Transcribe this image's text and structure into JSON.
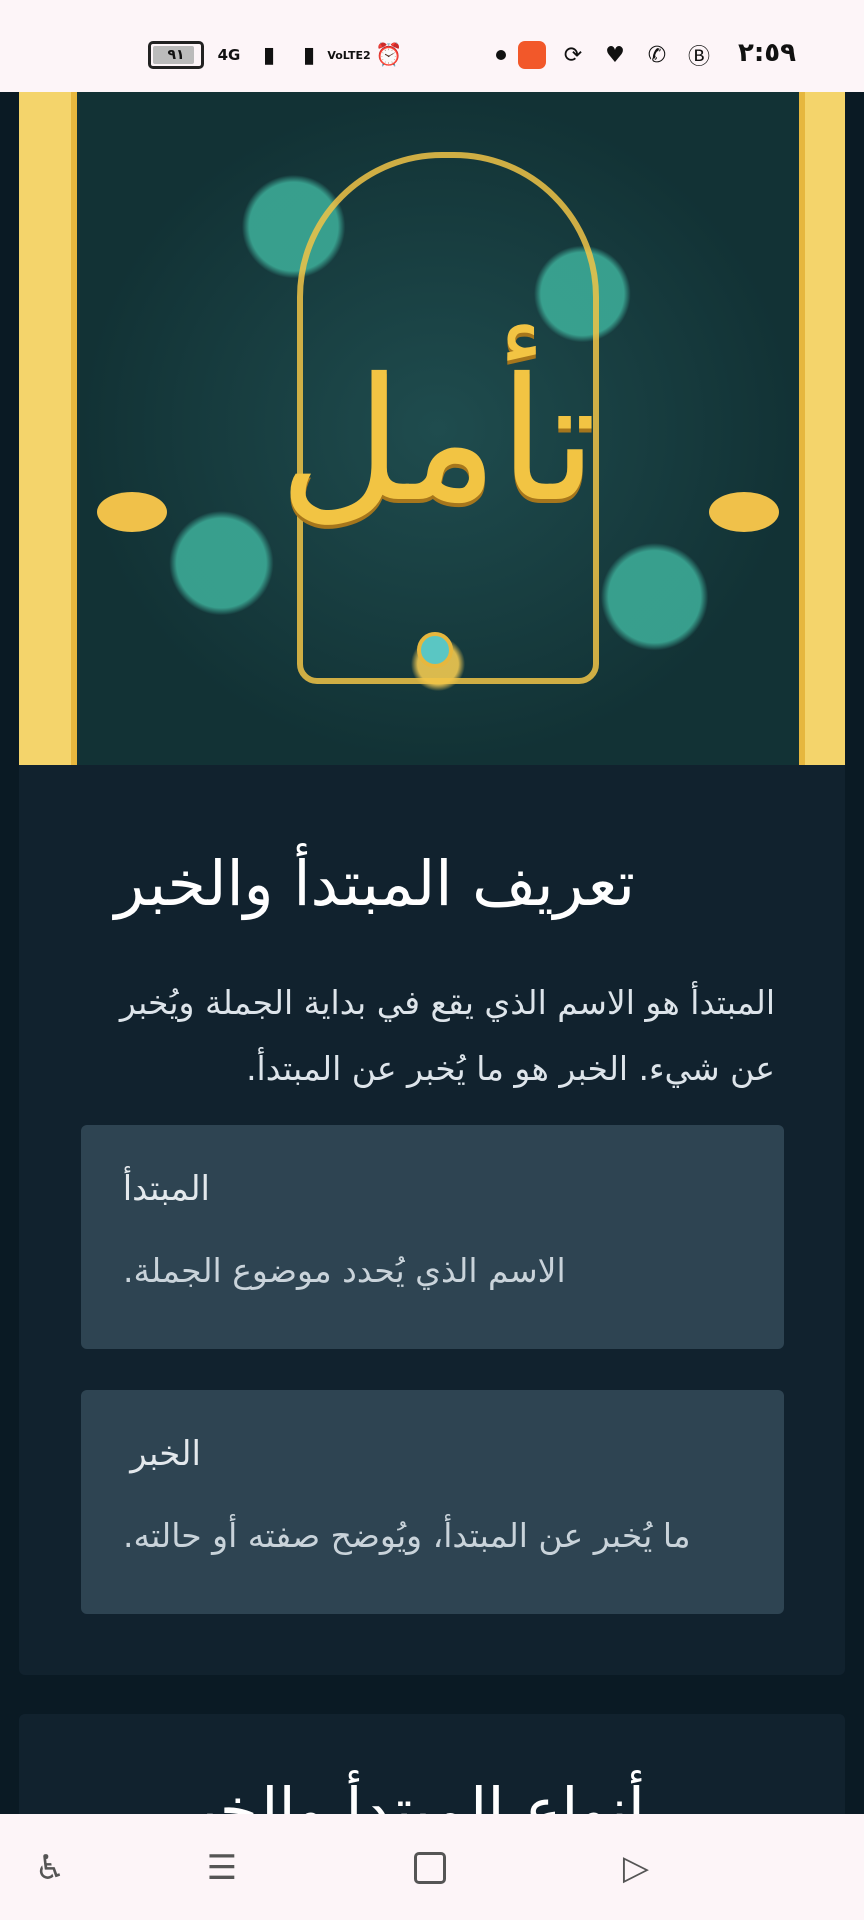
{
  "status_bar": {
    "time": "٢:٥٩",
    "battery": "٩١",
    "network": "4G",
    "volte": "VoLTE2"
  },
  "hero": {
    "calligraphy": "تأمل"
  },
  "card": {
    "title": "تعريف المبتدأ والخبر",
    "intro": "المبتدأ هو الاسم الذي يقع في بداية الجملة ويُخبر عن شيء. الخبر هو ما يُخبر عن المبتدأ.",
    "definitions": [
      {
        "term": "المبتدأ",
        "desc": "الاسم الذي يُحدد موضوع الجملة."
      },
      {
        "term": "الخبر",
        "desc": "ما يُخبر عن المبتدأ، ويُوضح صفته أو حالته."
      }
    ]
  },
  "card2": {
    "title_partial": "أنواع المبتدأ والخبر"
  },
  "nav_bar": {
    "accessibility": "♿",
    "menu": "☰",
    "back": "▷"
  }
}
